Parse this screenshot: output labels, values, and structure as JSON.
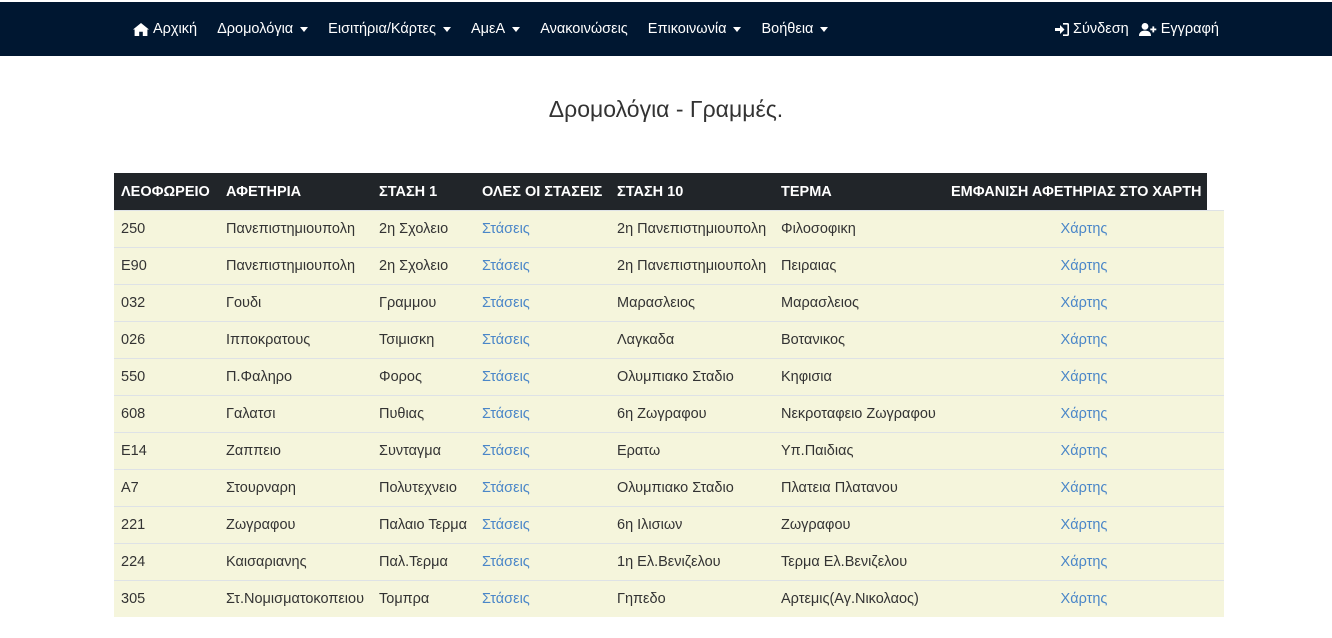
{
  "nav": {
    "left": [
      {
        "label": "Αρχική",
        "icon": "home-icon",
        "dropdown": false
      },
      {
        "label": "Δρομολόγια",
        "dropdown": true
      },
      {
        "label": "Εισιτήρια/Κάρτες",
        "dropdown": true
      },
      {
        "label": "ΑμεΑ",
        "dropdown": true
      },
      {
        "label": "Ανακοινώσεις",
        "dropdown": false
      },
      {
        "label": "Επικοινωνία",
        "dropdown": true
      },
      {
        "label": "Βοήθεια",
        "dropdown": true
      }
    ],
    "right": [
      {
        "label": "Σύνδεση",
        "icon": "sign-in-icon"
      },
      {
        "label": "Εγγραφή",
        "icon": "user-plus-icon"
      }
    ]
  },
  "page": {
    "title": "Δρομολόγια - Γραμμές."
  },
  "table": {
    "headers": [
      "ΛΕΟΦΩΡΕΙΟ",
      "ΑΦΕΤΗΡΙΑ",
      "ΣΤΑΣΗ 1",
      "ΟΛΕΣ ΟΙ ΣΤΑΣΕΙΣ",
      "ΣΤΑΣΗ 10",
      "ΤΕΡΜΑ",
      "ΕΜΦΑΝΙΣΗ ΑΦΕΤΗΡΙΑΣ ΣΤΟ ΧΑΡΤΗ"
    ],
    "stops_link_label": "Στάσεις",
    "map_link_label": "Χάρτης",
    "rows": [
      {
        "bus": "250",
        "start": "Πανεπιστημιουπολη",
        "stop1": "2η Σχολειο",
        "stop10": "2η Πανεπιστημιουπολη",
        "end": "Φιλοσοφικη"
      },
      {
        "bus": "Ε90",
        "start": "Πανεπιστημιουπολη",
        "stop1": "2η Σχολειο",
        "stop10": "2η Πανεπιστημιουπολη",
        "end": "Πειραιας"
      },
      {
        "bus": "032",
        "start": "Γουδι",
        "stop1": "Γραμμου",
        "stop10": "Μαρασλειος",
        "end": "Μαρασλειος"
      },
      {
        "bus": "026",
        "start": "Ιπποκρατους",
        "stop1": "Τσιμισκη",
        "stop10": "Λαγκαδα",
        "end": "Βοτανικος"
      },
      {
        "bus": "550",
        "start": "Π.Φαληρο",
        "stop1": "Φορος",
        "stop10": "Ολυμπιακο Σταδιο",
        "end": "Κηφισια"
      },
      {
        "bus": "608",
        "start": "Γαλατσι",
        "stop1": "Πυθιας",
        "stop10": "6η Ζωγραφου",
        "end": "Νεκροταφειο Ζωγραφου"
      },
      {
        "bus": "Ε14",
        "start": "Ζαππειο",
        "stop1": "Συνταγμα",
        "stop10": "Ερατω",
        "end": "Υπ.Παιδιας"
      },
      {
        "bus": "Α7",
        "start": "Στουρναρη",
        "stop1": "Πολυτεχνειο",
        "stop10": "Ολυμπιακο Σταδιο",
        "end": "Πλατεια Πλατανου"
      },
      {
        "bus": "221",
        "start": "Ζωγραφου",
        "stop1": "Παλαιο Τερμα",
        "stop10": "6η Ιλισιων",
        "end": "Ζωγραφου"
      },
      {
        "bus": "224",
        "start": "Καισαριανης",
        "stop1": "Παλ.Τερμα",
        "stop10": "1η Ελ.Βενιζελου",
        "end": "Τερμα Ελ.Βενιζελου"
      },
      {
        "bus": "305",
        "start": "Στ.Νομισματοκοπειου",
        "stop1": "Τομπρα",
        "stop10": "Γηπεδο",
        "end": "Αρτεμις(Αγ.Νικολαος)"
      }
    ]
  }
}
